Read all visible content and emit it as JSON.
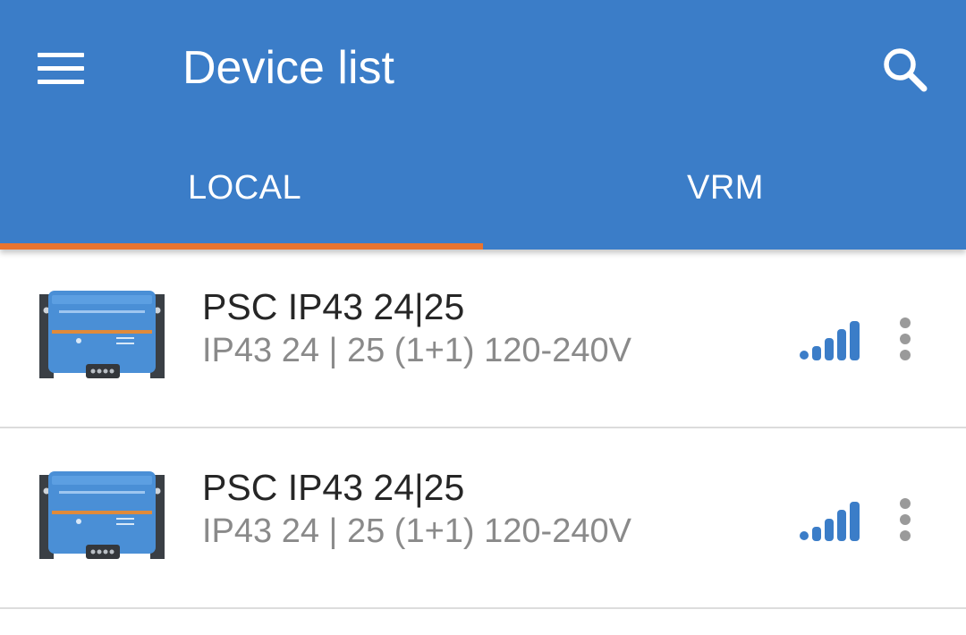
{
  "header": {
    "menu_icon": "menu-icon",
    "title": "Device list",
    "search_icon": "search-icon",
    "background_color": "#3b7dc8",
    "text_color": "#ffffff"
  },
  "tabs": [
    {
      "label": "LOCAL",
      "selected": true
    },
    {
      "label": "VRM",
      "selected": false
    }
  ],
  "tab_indicator_color": "#e8742f",
  "devices": [
    {
      "name": "PSC IP43 24|25",
      "description": "IP43 24 | 25 (1+1) 120-240V",
      "image_icon": "charger-device-image",
      "signal_icon": "signal-strength-icon",
      "signal_bars": 5,
      "more_icon": "more-vertical-icon"
    },
    {
      "name": "PSC IP43 24|25",
      "description": "IP43 24 | 25 (1+1) 120-240V",
      "image_icon": "charger-device-image",
      "signal_icon": "signal-strength-icon",
      "signal_bars": 5,
      "more_icon": "more-vertical-icon"
    }
  ],
  "colors": {
    "signal": "#3b7dc8",
    "device_body": "#4a8fd6",
    "device_orange": "#e08a3a",
    "divider": "#dcdcdc",
    "more_icon": "#9a9a9a"
  }
}
